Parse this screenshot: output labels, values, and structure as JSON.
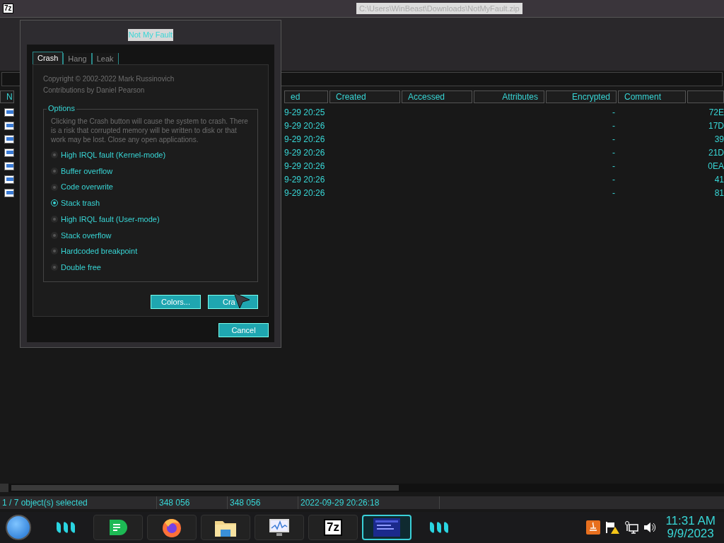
{
  "window": {
    "title": "C:\\Users\\WinBeast\\Downloads\\NotMyFault.zip",
    "icon_label": "7z"
  },
  "table": {
    "columns": [
      "N",
      "ed",
      "Created",
      "Accessed",
      "Attributes",
      "Encrypted",
      "Comment"
    ],
    "rows": [
      {
        "modified": "9-29 20:25",
        "encrypted": "-",
        "column_8": "72E"
      },
      {
        "modified": "9-29 20:26",
        "encrypted": "-",
        "column_8": "17D"
      },
      {
        "modified": "9-29 20:26",
        "encrypted": "-",
        "column_8": "39"
      },
      {
        "modified": "9-29 20:26",
        "encrypted": "-",
        "column_8": "21D"
      },
      {
        "modified": "9-29 20:26",
        "encrypted": "-",
        "column_8": "0EA"
      },
      {
        "modified": "9-29 20:26",
        "encrypted": "-",
        "column_8": "41"
      },
      {
        "modified": "9-29 20:26",
        "encrypted": "-",
        "column_8": "81"
      }
    ]
  },
  "status_bar": [
    "1 / 7 object(s) selected",
    "348 056",
    "348 056",
    "2022-09-29 20:26:18"
  ],
  "dialog": {
    "title": "Not My Fault",
    "tabs": [
      {
        "label": "Crash",
        "selected": true
      },
      {
        "label": "Hang",
        "selected": false
      },
      {
        "label": "Leak",
        "selected": false
      }
    ],
    "copyright": [
      "Copyright © 2002-2022 Mark Russinovich",
      "Contributions by Daniel Pearson"
    ],
    "group_label": "Options",
    "description": "Clicking the Crash button will cause the system to crash. There is a risk that corrupted memory will be written to disk or that work may be lost. Close any open applications.",
    "options": [
      {
        "label": "High IRQL fault (Kernel-mode)",
        "selected": false
      },
      {
        "label": "Buffer overflow",
        "selected": false
      },
      {
        "label": "Code overwrite",
        "selected": false
      },
      {
        "label": "Stack trash",
        "selected": true
      },
      {
        "label": "High IRQL fault (User-mode)",
        "selected": false
      },
      {
        "label": "Stack overflow",
        "selected": false
      },
      {
        "label": "Hardcoded breakpoint",
        "selected": false
      },
      {
        "label": "Double free",
        "selected": false
      }
    ],
    "colors_button": "Colors...",
    "crash_button": "Cra",
    "cancel_button": "Cancel"
  },
  "taskbar": {
    "apps": [
      {
        "kind": "chat",
        "selected": false
      },
      {
        "kind": "firefox",
        "selected": false
      },
      {
        "kind": "explorer",
        "selected": false
      },
      {
        "kind": "monitor",
        "selected": false
      },
      {
        "kind": "sevenzip",
        "label": "7z",
        "selected": false
      },
      {
        "kind": "window",
        "selected": true
      }
    ],
    "time": "11:31 AM",
    "date": "9/9/2023"
  }
}
